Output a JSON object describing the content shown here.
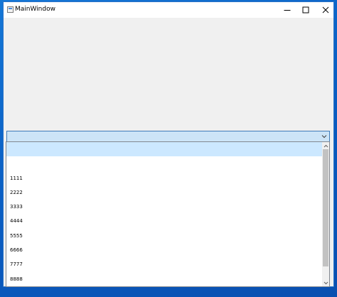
{
  "window": {
    "title": "MainWindow",
    "controls": {
      "minimize": "minimize-icon",
      "maximize": "maximize-icon",
      "close": "close-icon"
    }
  },
  "combobox": {
    "selected_value": "",
    "arrow": "chevron-down-icon"
  },
  "dropdown": {
    "items": [
      "",
      "",
      "1111",
      "2222",
      "3333",
      "4444",
      "5555",
      "6666",
      "7777",
      "8888"
    ],
    "highlighted_index": 0
  },
  "colors": {
    "desktop": "#0a5fc4",
    "client_background": "#f0f0f0",
    "selection": "#cce8ff",
    "combo_background": "#cce4f7",
    "combo_border": "#3d7bb8"
  }
}
